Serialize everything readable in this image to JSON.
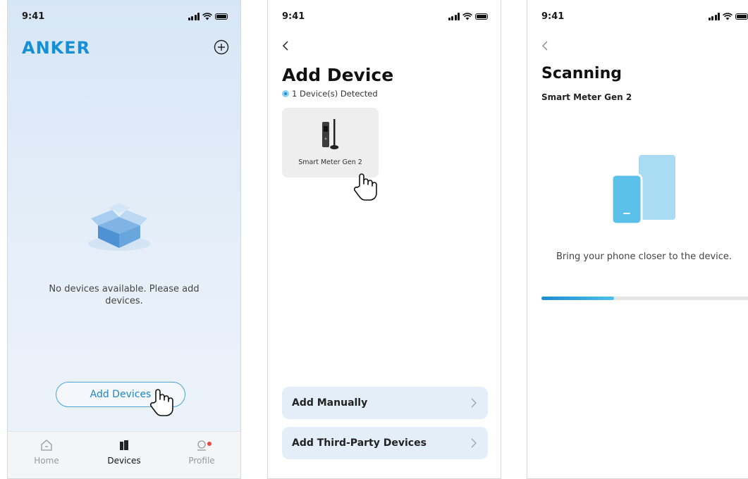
{
  "status": {
    "time": "9:41"
  },
  "screen1": {
    "brand": "ANKER",
    "empty_message": "No devices available. Please add devices.",
    "add_button": "Add Devices",
    "tabs": [
      {
        "label": "Home",
        "icon": "home-icon",
        "active": false
      },
      {
        "label": "Devices",
        "icon": "devices-icon",
        "active": true
      },
      {
        "label": "Profile",
        "icon": "profile-icon",
        "active": false,
        "badge": true
      }
    ]
  },
  "screen2": {
    "title": "Add Device",
    "detected": "1 Device(s) Detected",
    "device_name": "Smart Meter Gen 2",
    "options": [
      {
        "label": "Add Manually"
      },
      {
        "label": "Add Third-Party Devices"
      }
    ]
  },
  "screen3": {
    "title": "Scanning",
    "subtitle": "Smart Meter Gen 2",
    "hint": "Bring your phone closer to the device.",
    "progress": 0.33
  },
  "colors": {
    "brand": "#1590d6",
    "accent": "#1f86c8",
    "badge": "#e84b3c"
  }
}
